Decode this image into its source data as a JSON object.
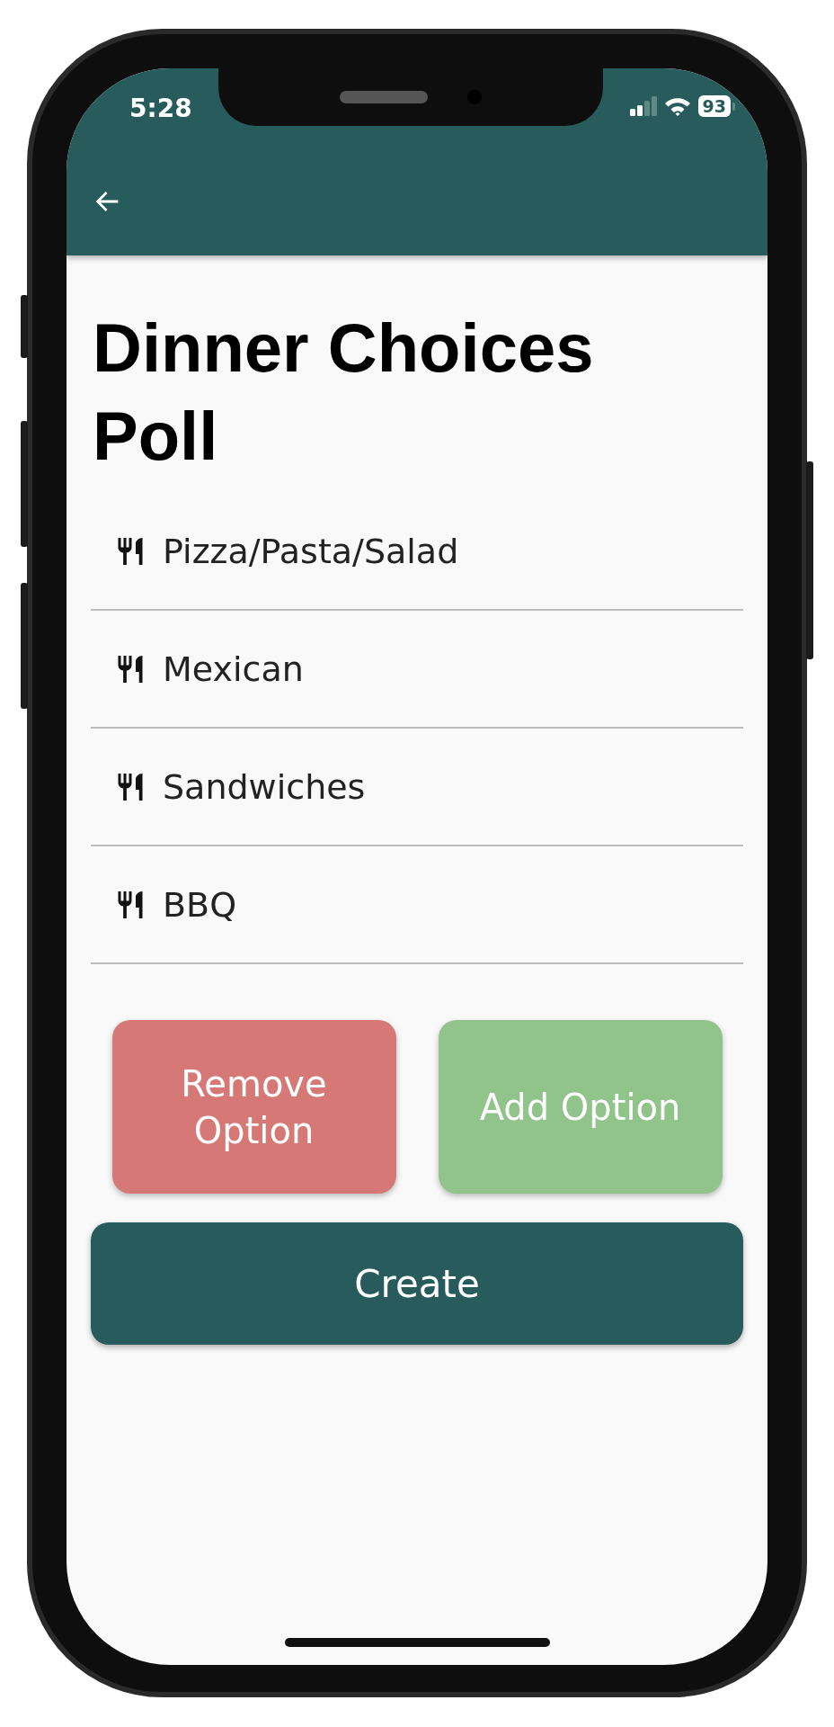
{
  "status_bar": {
    "time": "5:28",
    "battery": "93"
  },
  "title": "Dinner Choices Poll",
  "options": [
    {
      "value": "Pizza/Pasta/Salad"
    },
    {
      "value": "Mexican"
    },
    {
      "value": "Sandwiches"
    },
    {
      "value": "BBQ"
    }
  ],
  "buttons": [
    {
      "kind": "remove",
      "label": "Remove Option"
    },
    {
      "kind": "add",
      "label": "Add Option"
    }
  ],
  "create_button": {
    "label": "Create"
  }
}
